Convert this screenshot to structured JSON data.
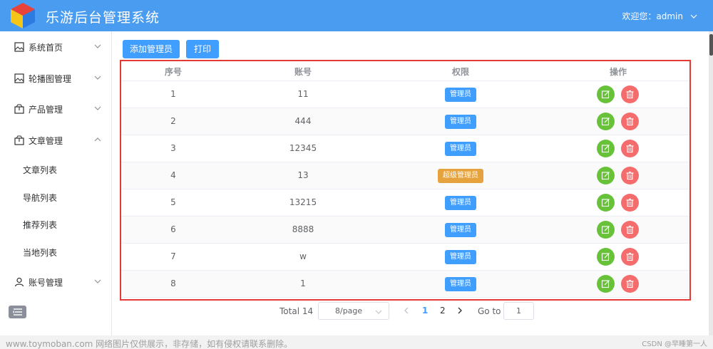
{
  "header": {
    "app_title": "乐游后台管理系统",
    "user_greeting": "欢迎您：admin"
  },
  "sidebar": {
    "items": [
      {
        "label": "系统首页",
        "icon": "image-icon",
        "expanded": false
      },
      {
        "label": "轮播图管理",
        "icon": "image-icon",
        "expanded": false
      },
      {
        "label": "产品管理",
        "icon": "box-icon",
        "expanded": false
      },
      {
        "label": "文章管理",
        "icon": "box-icon",
        "expanded": true
      },
      {
        "label": "账号管理",
        "icon": "user-icon",
        "expanded": false
      }
    ],
    "sub_items": [
      "文章列表",
      "导航列表",
      "推荐列表",
      "当地列表"
    ]
  },
  "toolbar": {
    "add_label": "添加管理员",
    "print_label": "打印"
  },
  "table": {
    "columns": [
      "序号",
      "账号",
      "权限",
      "操作"
    ],
    "rows": [
      {
        "index": "1",
        "account": "11",
        "role": "管理员",
        "role_type": "admin"
      },
      {
        "index": "2",
        "account": "444",
        "role": "管理员",
        "role_type": "admin"
      },
      {
        "index": "3",
        "account": "12345",
        "role": "管理员",
        "role_type": "admin"
      },
      {
        "index": "4",
        "account": "13",
        "role": "超级管理员",
        "role_type": "super"
      },
      {
        "index": "5",
        "account": "13215",
        "role": "管理员",
        "role_type": "admin"
      },
      {
        "index": "6",
        "account": "8888",
        "role": "管理员",
        "role_type": "admin"
      },
      {
        "index": "7",
        "account": "w",
        "role": "管理员",
        "role_type": "admin"
      },
      {
        "index": "8",
        "account": "1",
        "role": "管理员",
        "role_type": "admin"
      }
    ]
  },
  "pagination": {
    "total": "Total 14",
    "page_size": "8/page",
    "pages": [
      "1",
      "2"
    ],
    "current_page": "1",
    "goto_label": "Go to",
    "goto_value": "1"
  },
  "footer": {
    "watermark": "www.toymoban.com 网络图片仅供展示，非存储，如有侵权请联系删除。",
    "credit": "CSDN @早睡第一人"
  },
  "colors": {
    "header": "#4a9cf0",
    "primary": "#409eff",
    "warning": "#e6a23c",
    "success": "#67c23a",
    "danger": "#f56c6c",
    "highlight_border": "#e53935"
  }
}
